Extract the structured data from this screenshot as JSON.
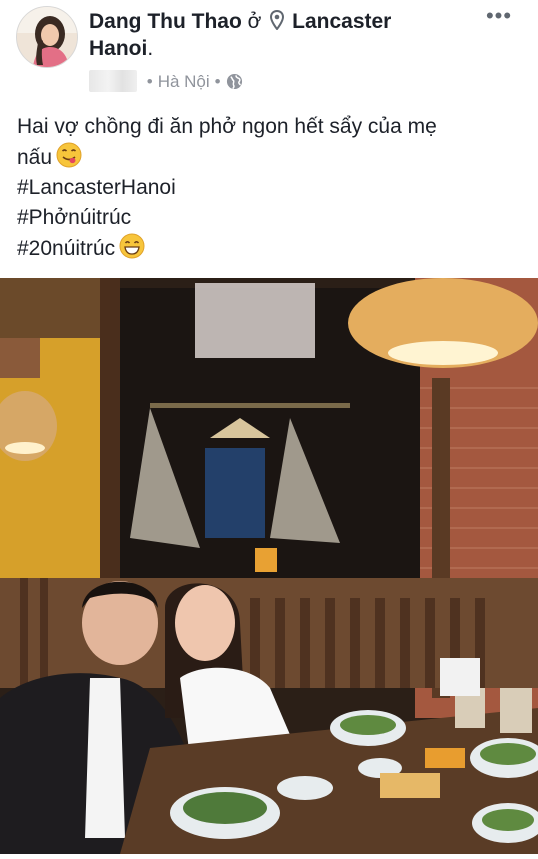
{
  "post": {
    "author": "Dang Thu Thao",
    "connector": "ở",
    "place_line1": "Lancaster",
    "place_line2": "Hanoi",
    "place_suffix": ".",
    "location": "Hà Nội",
    "separator": "•",
    "more_label": "•••",
    "text_lines": [
      "Hai vợ chồng đi ăn phở ngon hết sẩy của mẹ",
      "nấu",
      "#LancasterHanoi",
      "#Phởnúitrúc",
      "#20núitrúc"
    ]
  },
  "icons": {
    "pin": "location-pin-icon",
    "globe": "globe-icon",
    "emoji1": "face-savoring-food-emoji",
    "emoji2": "grinning-smiling-eyes-emoji",
    "more": "more-options-icon"
  },
  "colors": {
    "text": "#1d2129",
    "meta": "#90949c",
    "lamp": "#e6b060",
    "brick": "#a85a43",
    "wall_yellow": "#d9a32a"
  }
}
